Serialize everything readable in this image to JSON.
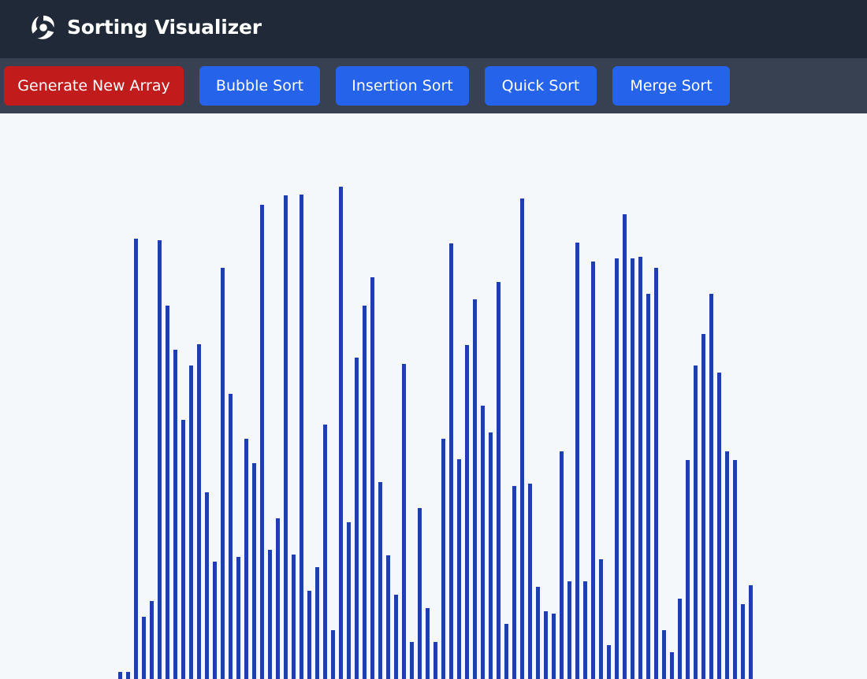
{
  "header": {
    "title": "Sorting Visualizer",
    "logo_icon": "swirl-logo-icon"
  },
  "toolbar": {
    "buttons": [
      {
        "id": "generate",
        "label": "Generate New Array",
        "color": "#c21b1b"
      },
      {
        "id": "bubble",
        "label": "Bubble Sort",
        "color": "#2563eb"
      },
      {
        "id": "insertion",
        "label": "Insertion Sort",
        "color": "#2563eb"
      },
      {
        "id": "quick",
        "label": "Quick Sort",
        "color": "#2563eb"
      },
      {
        "id": "merge",
        "label": "Merge Sort",
        "color": "#2563eb"
      }
    ]
  },
  "visualizer": {
    "bar_color": "#1e40af",
    "array_values": [
      9,
      9,
      559,
      79,
      99,
      557,
      474,
      418,
      329,
      398,
      425,
      237,
      149,
      522,
      362,
      155,
      305,
      274,
      602,
      164,
      204,
      614,
      158,
      615,
      112,
      142,
      323,
      62,
      625,
      199,
      408,
      474,
      510,
      250,
      157,
      107,
      400,
      47,
      217,
      90,
      47,
      305,
      553,
      279,
      424,
      482,
      347,
      313,
      504,
      70,
      245,
      610,
      248,
      117,
      86,
      83,
      289,
      124,
      554,
      124,
      530,
      152,
      43,
      534,
      590,
      534,
      536,
      489,
      522,
      62,
      34,
      102,
      278,
      398,
      438,
      489,
      389,
      289,
      278,
      95,
      119
    ]
  }
}
